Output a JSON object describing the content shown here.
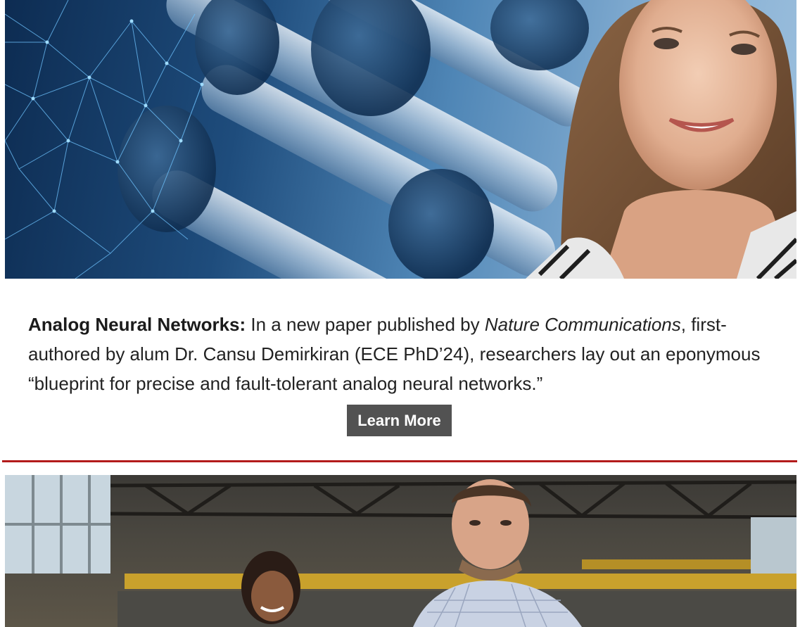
{
  "feature": {
    "lead": "Analog Neural Networks:",
    "text_1": " In a new paper published by ",
    "journal": "Nature Communications",
    "text_2": ", first-authored by alum Dr. Cansu Demirkiran (ECE PhD’24), researchers lay out an eponymous “blueprint for precise and fault-tolerant analog neural networks.”",
    "button_label": "Learn More"
  },
  "colors": {
    "divider": "#b31b1b",
    "button_bg": "#525252",
    "button_text": "#ffffff"
  }
}
